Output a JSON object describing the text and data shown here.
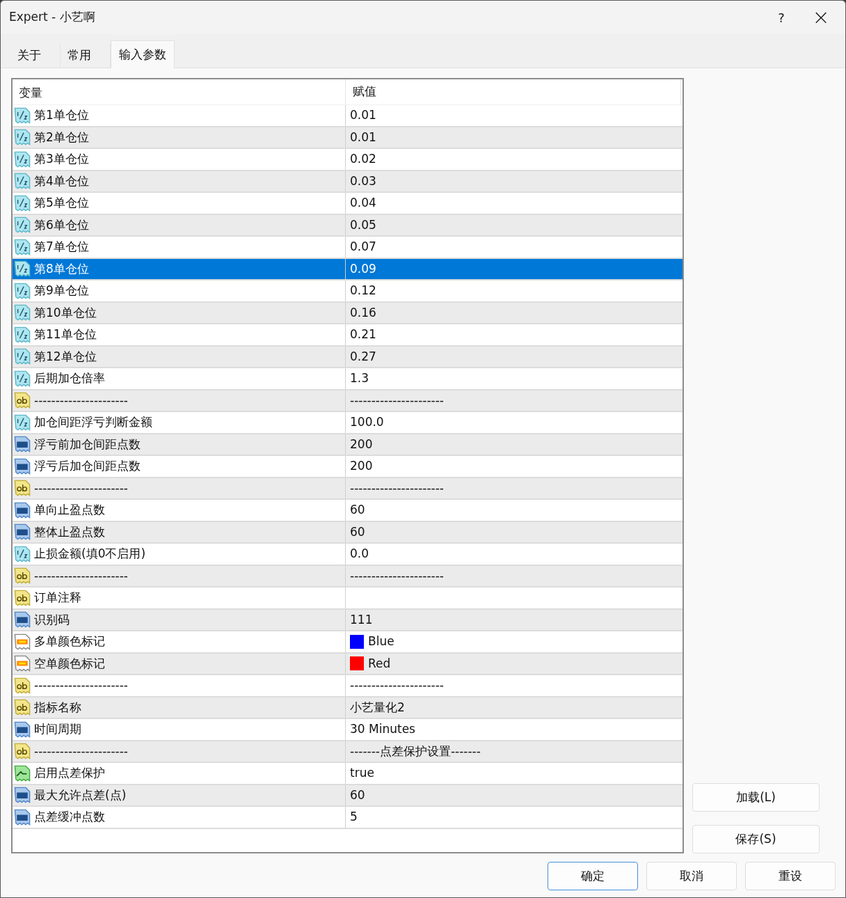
{
  "window": {
    "title": "Expert - 小艺啊",
    "help": "?",
    "close": "×"
  },
  "tabs": [
    {
      "label": "关于",
      "selected": false
    },
    {
      "label": "常用",
      "selected": false
    },
    {
      "label": "输入参数",
      "selected": true
    }
  ],
  "table": {
    "columns": [
      "变量",
      "赋值"
    ],
    "rows": [
      {
        "kind": "double",
        "name": "第1单仓位",
        "value": "0.01",
        "selected": false
      },
      {
        "kind": "double",
        "name": "第2单仓位",
        "value": "0.01",
        "selected": false
      },
      {
        "kind": "double",
        "name": "第3单仓位",
        "value": "0.02",
        "selected": false
      },
      {
        "kind": "double",
        "name": "第4单仓位",
        "value": "0.03",
        "selected": false
      },
      {
        "kind": "double",
        "name": "第5单仓位",
        "value": "0.04",
        "selected": false
      },
      {
        "kind": "double",
        "name": "第6单仓位",
        "value": "0.05",
        "selected": false
      },
      {
        "kind": "double",
        "name": "第7单仓位",
        "value": "0.07",
        "selected": false
      },
      {
        "kind": "double",
        "name": "第8单仓位",
        "value": "0.09",
        "selected": true
      },
      {
        "kind": "double",
        "name": "第9单仓位",
        "value": "0.12",
        "selected": false
      },
      {
        "kind": "double",
        "name": "第10单仓位",
        "value": "0.16",
        "selected": false
      },
      {
        "kind": "double",
        "name": "第11单仓位",
        "value": "0.21",
        "selected": false
      },
      {
        "kind": "double",
        "name": "第12单仓位",
        "value": "0.27",
        "selected": false
      },
      {
        "kind": "double",
        "name": "后期加仓倍率",
        "value": "1.3",
        "selected": false
      },
      {
        "kind": "string",
        "name": "----------------------",
        "value": "----------------------",
        "selected": false
      },
      {
        "kind": "double",
        "name": "加仓间距浮亏判断金额",
        "value": "100.0",
        "selected": false
      },
      {
        "kind": "int",
        "name": "浮亏前加仓间距点数",
        "value": "200",
        "selected": false
      },
      {
        "kind": "int",
        "name": "浮亏后加仓间距点数",
        "value": "200",
        "selected": false
      },
      {
        "kind": "string",
        "name": "----------------------",
        "value": "----------------------",
        "selected": false
      },
      {
        "kind": "int",
        "name": "单向止盈点数",
        "value": "60",
        "selected": false
      },
      {
        "kind": "int",
        "name": "整体止盈点数",
        "value": "60",
        "selected": false
      },
      {
        "kind": "double",
        "name": "止损金额(填0不启用)",
        "value": "0.0",
        "selected": false
      },
      {
        "kind": "string",
        "name": "----------------------",
        "value": "----------------------",
        "selected": false
      },
      {
        "kind": "string",
        "name": "订单注释",
        "selected": false
      },
      {
        "kind": "int",
        "name": "识别码",
        "value": "111",
        "selected": false
      },
      {
        "kind": "color",
        "name": "多单颜色标记",
        "value": "Blue",
        "color": "#0000ff",
        "selected": false
      },
      {
        "kind": "color",
        "name": "空单颜色标记",
        "value": "Red",
        "color": "#ff0000",
        "selected": false
      },
      {
        "kind": "string",
        "name": "----------------------",
        "value": "----------------------",
        "selected": false
      },
      {
        "kind": "string",
        "name": "指标名称",
        "value": "小艺量化2",
        "selected": false
      },
      {
        "kind": "int",
        "name": "时间周期",
        "value": "30 Minutes",
        "selected": false
      },
      {
        "kind": "string",
        "name": "----------------------",
        "value": "-------点差保护设置-------",
        "selected": false
      },
      {
        "kind": "bool",
        "name": "启用点差保护",
        "value": "true",
        "selected": false
      },
      {
        "kind": "int",
        "name": "最大允许点差(点)",
        "value": "60",
        "selected": false
      },
      {
        "kind": "int",
        "name": "点差缓冲点数",
        "value": "5",
        "selected": false
      }
    ]
  },
  "side_buttons": [
    "加载(L)",
    "保存(S)"
  ],
  "buttons": [
    {
      "label": "确定",
      "default": true
    },
    {
      "label": "取消",
      "default": false
    },
    {
      "label": "重设",
      "default": false
    }
  ]
}
